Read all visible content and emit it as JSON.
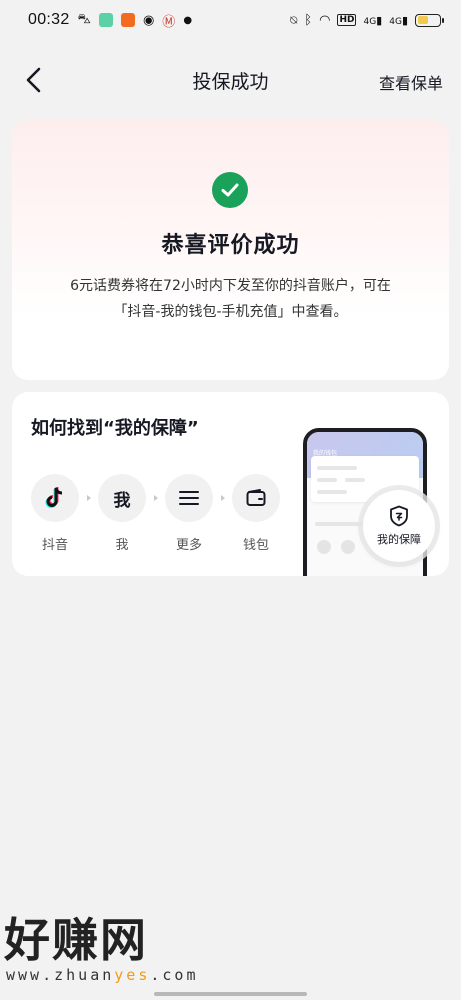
{
  "status_bar": {
    "time": "00:32",
    "signal_left": "4G",
    "signal_right": "4G",
    "hd_label": "HD"
  },
  "nav": {
    "title": "投保成功",
    "right_link": "查看保单"
  },
  "success": {
    "title": "恭喜评价成功",
    "line1": "6元话费券将在72小时内下发至你的抖音账户，可在",
    "line2": "「抖音-我的钱包-手机充值」中查看。"
  },
  "guide": {
    "title": "如何找到“我的保障”",
    "steps": [
      {
        "label": "抖音",
        "icon": "douyin-icon"
      },
      {
        "label": "我",
        "icon_text": "我"
      },
      {
        "label": "更多",
        "icon": "menu-icon"
      },
      {
        "label": "钱包",
        "icon": "wallet-icon"
      }
    ],
    "preview": {
      "header_text": "我的钱包",
      "badge_label": "我的保障"
    }
  },
  "watermark": {
    "brand": "好赚网",
    "url_prefix": "www.zhuan",
    "url_highlight": "yes",
    "url_suffix": ".com"
  },
  "colors": {
    "success_green": "#1aa25a",
    "background": "#f2f2f2",
    "card_top_tint": "#fdeeee",
    "watermark_highlight": "#f29a1a"
  }
}
